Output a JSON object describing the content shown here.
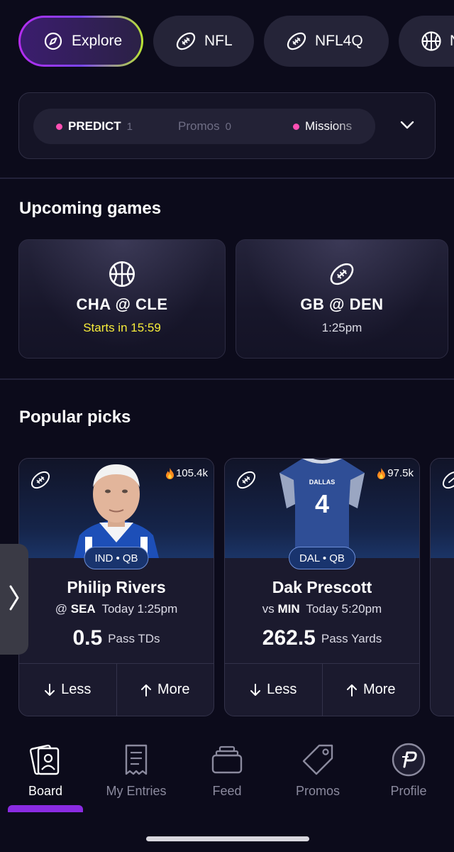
{
  "sport_tabs": [
    {
      "label": "Explore",
      "icon": "compass-icon"
    },
    {
      "label": "NFL",
      "icon": "football-icon"
    },
    {
      "label": "NFL4Q",
      "icon": "football-icon"
    },
    {
      "label": "N",
      "icon": "basketball-icon"
    }
  ],
  "promo_strip": {
    "items": [
      {
        "label": "PREDICT",
        "count": "1",
        "dot": true
      },
      {
        "label": "Promos",
        "count": "0",
        "dot": false
      },
      {
        "label": "Missions",
        "count": "",
        "dot": true
      }
    ]
  },
  "upcoming": {
    "title": "Upcoming games",
    "games": [
      {
        "matchup": "CHA @ CLE",
        "time": "Starts in 15:59",
        "sport_icon": "basketball-icon"
      },
      {
        "matchup": "GB @ DEN",
        "time": "1:25pm",
        "sport_icon": "football-icon"
      }
    ]
  },
  "popular": {
    "title": "Popular picks",
    "picks": [
      {
        "trend": "105.4k",
        "team_pos": "IND • QB",
        "name": "Philip Rivers",
        "opp_prefix": "@",
        "opp_team": "SEA",
        "time": "Today 1:25pm",
        "line": "0.5",
        "stat": "Pass TDs",
        "less": "Less",
        "more": "More"
      },
      {
        "trend": "97.5k",
        "team_pos": "DAL • QB",
        "name": "Dak Prescott",
        "opp_prefix": "vs",
        "opp_team": "MIN",
        "time": "Today 5:20pm",
        "line": "262.5",
        "stat": "Pass Yards",
        "less": "Less",
        "more": "More",
        "jersey_text": "DALLAS",
        "jersey_number": "4"
      }
    ]
  },
  "bottom_nav": [
    {
      "label": "Board",
      "icon": "board-icon",
      "active": true
    },
    {
      "label": "My Entries",
      "icon": "receipt-icon",
      "active": false
    },
    {
      "label": "Feed",
      "icon": "feed-icon",
      "active": false
    },
    {
      "label": "Promos",
      "icon": "tag-icon",
      "active": false
    },
    {
      "label": "Profile",
      "icon": "profile-icon",
      "active": false
    }
  ],
  "colors": {
    "background": "#0c0b1b",
    "accent_purple": "#8a2be2",
    "live_yellow": "#f7ec3a",
    "dot_pink": "#ff4fb3"
  }
}
